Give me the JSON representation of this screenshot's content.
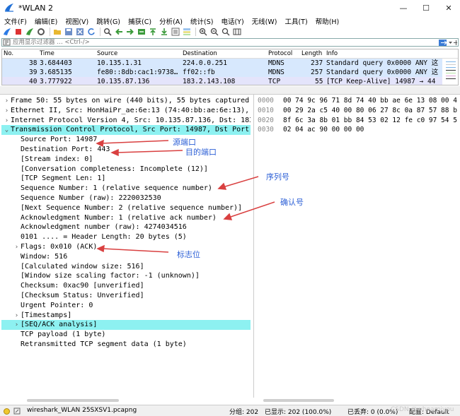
{
  "window": {
    "title": "*WLAN 2",
    "minimize": "—",
    "maximize": "☐",
    "close": "✕"
  },
  "menu": [
    "文件(F)",
    "编辑(E)",
    "视图(V)",
    "跳转(G)",
    "捕获(C)",
    "分析(A)",
    "统计(S)",
    "电话(Y)",
    "无线(W)",
    "工具(T)",
    "帮助(H)"
  ],
  "filter": {
    "placeholder": "应用显示过滤器 … <Ctrl-/>"
  },
  "packet_list": {
    "columns": [
      "No.",
      "Time",
      "Source",
      "Destination",
      "Protocol",
      "Length",
      "Info"
    ],
    "rows": [
      {
        "no": "38",
        "time": "3.684403",
        "source": "10.135.1.31",
        "destination": "224.0.0.251",
        "protocol": "MDNS",
        "length": "237",
        "info": "Standard query 0x0000 ANY 这"
      },
      {
        "no": "39",
        "time": "3.685135",
        "source": "fe80::8db:cac1:9738…",
        "destination": "ff02::fb",
        "protocol": "MDNS",
        "length": "257",
        "info": "Standard query 0x0000 ANY 这"
      },
      {
        "no": "40",
        "time": "3.777922",
        "source": "10.135.87.136",
        "destination": "183.2.143.108",
        "protocol": "TCP",
        "length": "55",
        "info": "[TCP Keep-Alive] 14987 → 44"
      }
    ]
  },
  "details": [
    {
      "text": "Frame 50: 55 bytes on wire (440 bits), 55 bytes captured (4",
      "arrow": "›",
      "indent": 0
    },
    {
      "text": "Ethernet II, Src: HonHaiPr_ae:6e:13 (74:40:bb:ae:6e:13), Ds",
      "arrow": "›",
      "indent": 0
    },
    {
      "text": "Internet Protocol Version 4, Src: 10.135.87.136, Dst: 183.2.",
      "arrow": "›",
      "indent": 0
    },
    {
      "text": "Transmission Control Protocol, Src Port: 14987, Dst Port: 4",
      "arrow": "⌄",
      "indent": 0,
      "highlight": true
    },
    {
      "text": "Source Port: 14987",
      "arrow": "",
      "indent": 1
    },
    {
      "text": "Destination Port: 443",
      "arrow": "",
      "indent": 1
    },
    {
      "text": "[Stream index: 0]",
      "arrow": "",
      "indent": 1
    },
    {
      "text": "[Conversation completeness: Incomplete (12)]",
      "arrow": "",
      "indent": 1
    },
    {
      "text": "[TCP Segment Len: 1]",
      "arrow": "",
      "indent": 1
    },
    {
      "text": "Sequence Number: 1    (relative sequence number)",
      "arrow": "",
      "indent": 1
    },
    {
      "text": "Sequence Number (raw): 2220032530",
      "arrow": "",
      "indent": 1
    },
    {
      "text": "[Next Sequence Number: 2    (relative sequence number)]",
      "arrow": "",
      "indent": 1
    },
    {
      "text": "Acknowledgment Number: 1    (relative ack number)",
      "arrow": "",
      "indent": 1
    },
    {
      "text": "Acknowledgment number (raw): 4274034516",
      "arrow": "",
      "indent": 1
    },
    {
      "text": "0101 .... = Header Length: 20 bytes (5)",
      "arrow": "",
      "indent": 1
    },
    {
      "text": "Flags: 0x010 (ACK)",
      "arrow": "›",
      "indent": 1
    },
    {
      "text": "Window: 516",
      "arrow": "",
      "indent": 1
    },
    {
      "text": "[Calculated window size: 516]",
      "arrow": "",
      "indent": 1
    },
    {
      "text": "[Window size scaling factor: -1 (unknown)]",
      "arrow": "",
      "indent": 1
    },
    {
      "text": "Checksum: 0xac90 [unverified]",
      "arrow": "",
      "indent": 1
    },
    {
      "text": "[Checksum Status: Unverified]",
      "arrow": "",
      "indent": 1
    },
    {
      "text": "Urgent Pointer: 0",
      "arrow": "",
      "indent": 1
    },
    {
      "text": "[Timestamps]",
      "arrow": "›",
      "indent": 1
    },
    {
      "text": "[SEQ/ACK analysis]",
      "arrow": "›",
      "indent": 1,
      "highlight": true
    },
    {
      "text": "TCP payload (1 byte)",
      "arrow": "",
      "indent": 1
    },
    {
      "text": "Retransmitted TCP segment data (1 byte)",
      "arrow": "",
      "indent": 1
    }
  ],
  "hex": [
    {
      "offset": "0000",
      "bytes": "00 74 9c 96 71 8d 74 40  bb ae 6e 13 08 00 4"
    },
    {
      "offset": "0010",
      "bytes": "00 29 2a c5 40 00 80 06  27 8c 0a 87 57 88 b"
    },
    {
      "offset": "0020",
      "bytes": "8f 6c 3a 8b 01 bb 84 53  02 12 fe c0 97 54 5"
    },
    {
      "offset": "0030",
      "bytes": "02 04 ac 90 00 00 00"
    }
  ],
  "annotations": {
    "src_port": "源端口",
    "dst_port": "目的端口",
    "seq": "序列号",
    "ack": "确认号",
    "flags": "标志位"
  },
  "status": {
    "file": "wireshark_WLAN 25SXSV1.pcapng",
    "groups": "分组: 202",
    "displayed": "已显示: 202 (100.0%)",
    "dropped": "已丢弃: 0 (0.0%)",
    "profile": "配置: Default",
    "watermark": "CSDN @whoamiyou"
  },
  "colors": {
    "highlight": "#8df1f1",
    "mdns_row": "#d7e8fd",
    "annotation": "#2c5fd6",
    "arrow": "#d94040"
  }
}
